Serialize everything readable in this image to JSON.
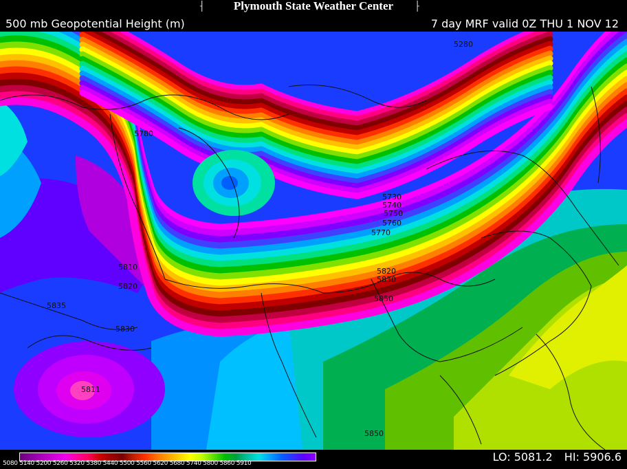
{
  "header": {
    "center_title": "Plymouth State Weather Center",
    "left_title": "500 mb Geopotential Height (m)",
    "right_title": "7 day MRF valid 0Z THU 1 NOV 12"
  },
  "footer": {
    "colorbar_ticks": "5080 5140 5200 5260 5320 5380 5440 5500 5560 5620 5680 5740 5800 5860 5910",
    "lo": "LO: 5081.2",
    "hi": "HI: 5906.6"
  },
  "contour_labels": [
    "5280",
    "5780",
    "5810",
    "5820",
    "5835",
    "5830",
    "5811",
    "5850",
    "5850",
    "5770",
    "5760",
    "5750",
    "5740",
    "5730",
    "5830",
    "5820"
  ],
  "palette": [
    "#6a0078",
    "#8a00a0",
    "#b000c0",
    "#d000d8",
    "#f000f0",
    "#ff00a0",
    "#ff0060",
    "#d00000",
    "#a00000",
    "#7a0000",
    "#c02000",
    "#ff3000",
    "#ff7000",
    "#ffa000",
    "#ffd000",
    "#ffff00",
    "#c0ff00",
    "#60e000",
    "#00c000",
    "#00a040",
    "#00c0a0",
    "#00e0e0",
    "#00a0ff",
    "#0060ff",
    "#3030ff",
    "#6000ff",
    "#9000ff"
  ]
}
